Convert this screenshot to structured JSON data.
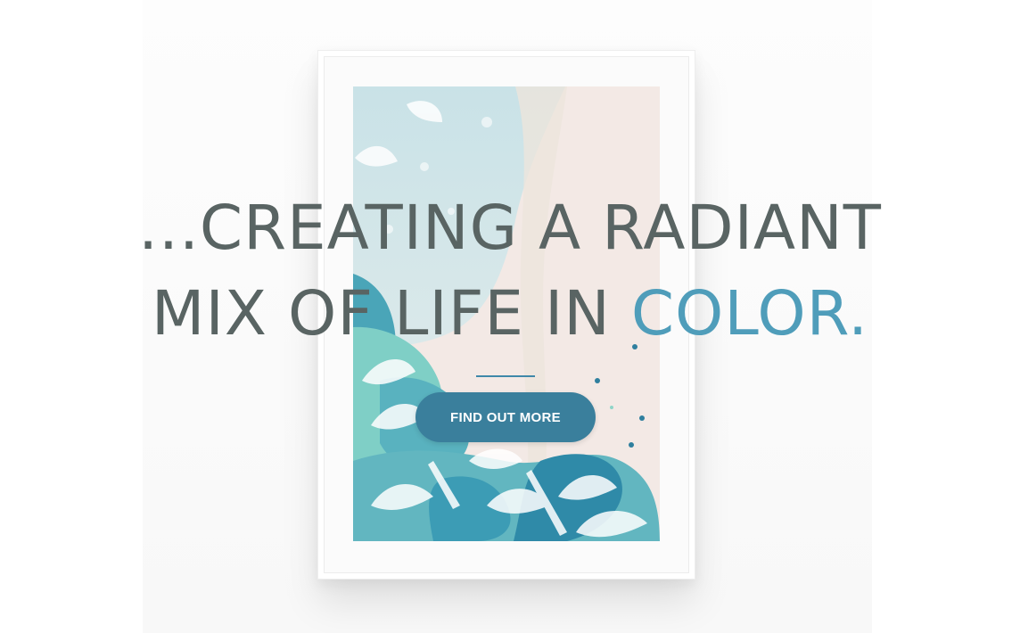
{
  "hero": {
    "headline_line1": "...CREATING A RADIANT",
    "headline_line2_prefix": "MIX OF LIFE IN ",
    "headline_line2_accent": "COLOR.",
    "cta_label": "FIND OUT MORE"
  },
  "colors": {
    "headline": "#596463",
    "accent": "#4f9dba",
    "button": "#3a7f9c",
    "divider": "#3f88a9"
  },
  "image": {
    "icon": "framed-abstract-painting"
  }
}
